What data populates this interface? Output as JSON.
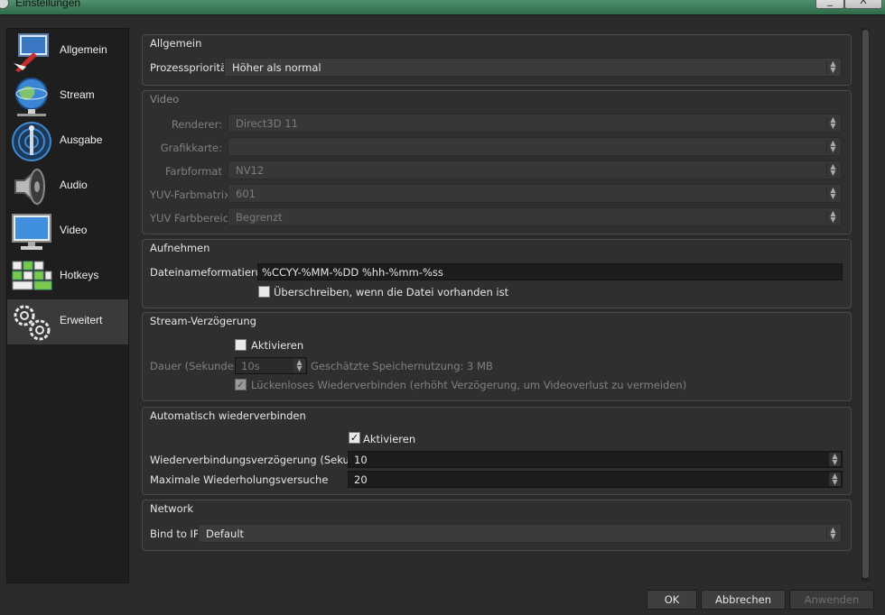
{
  "window": {
    "title": "Einstellungen",
    "minimize_glyph": "_",
    "close_glyph": "X"
  },
  "sidebar": {
    "items": [
      {
        "label": "Allgemein",
        "icon": "general-settings-icon",
        "active": false
      },
      {
        "label": "Stream",
        "icon": "globe-network-icon",
        "active": false
      },
      {
        "label": "Ausgabe",
        "icon": "broadcast-antenna-icon",
        "active": false
      },
      {
        "label": "Audio",
        "icon": "speaker-icon",
        "active": false
      },
      {
        "label": "Video",
        "icon": "monitor-icon",
        "active": false
      },
      {
        "label": "Hotkeys",
        "icon": "keyboard-icon",
        "active": false
      },
      {
        "label": "Erweitert",
        "icon": "gears-icon",
        "active": true
      }
    ]
  },
  "sections": {
    "general": {
      "title": "Allgemein",
      "priority_label": "Prozesspriorität",
      "priority_value": "Höher als normal"
    },
    "video": {
      "title": "Video",
      "renderer_label": "Renderer:",
      "renderer_value": "Direct3D 11",
      "gpu_label": "Grafikkarte:",
      "gpu_value": "",
      "format_label": "Farbformat",
      "format_value": "NV12",
      "matrix_label": "YUV-Farbmatrix",
      "matrix_value": "601",
      "range_label": "YUV Farbbereich",
      "range_value": "Begrenzt"
    },
    "recording": {
      "title": "Aufnehmen",
      "filename_label": "Dateinameformatierung",
      "filename_value": "%CCYY-%MM-%DD %hh-%mm-%ss",
      "overwrite_label": "Überschreiben, wenn die Datei vorhanden ist",
      "overwrite_checked": false
    },
    "stream_delay": {
      "title": "Stream-Verzögerung",
      "enable_label": "Aktivieren",
      "enable_checked": false,
      "duration_label": "Dauer (Sekunden)",
      "duration_value": "10s",
      "memory_text": "Geschätzte Speichernutzung: 3 MB",
      "preserve_label": "Lückenloses Wiederverbinden (erhöht Verzögerung, um Videoverlust zu vermeiden)",
      "preserve_checked": true
    },
    "reconnect": {
      "title": "Automatisch wiederverbinden",
      "enable_label": "Aktivieren",
      "enable_checked": true,
      "delay_label": "Wiederverbindungsverzögerung (Sekunden)",
      "delay_value": "10",
      "retries_label": "Maximale Wiederholungsversuche",
      "retries_value": "20"
    },
    "network": {
      "title": "Network",
      "bind_label": "Bind to IP",
      "bind_value": "Default"
    }
  },
  "buttons": {
    "ok": "OK",
    "cancel": "Abbrechen",
    "apply": "Anwenden"
  },
  "glyphs": {
    "check": "✓",
    "spin": "▲\n▼"
  }
}
